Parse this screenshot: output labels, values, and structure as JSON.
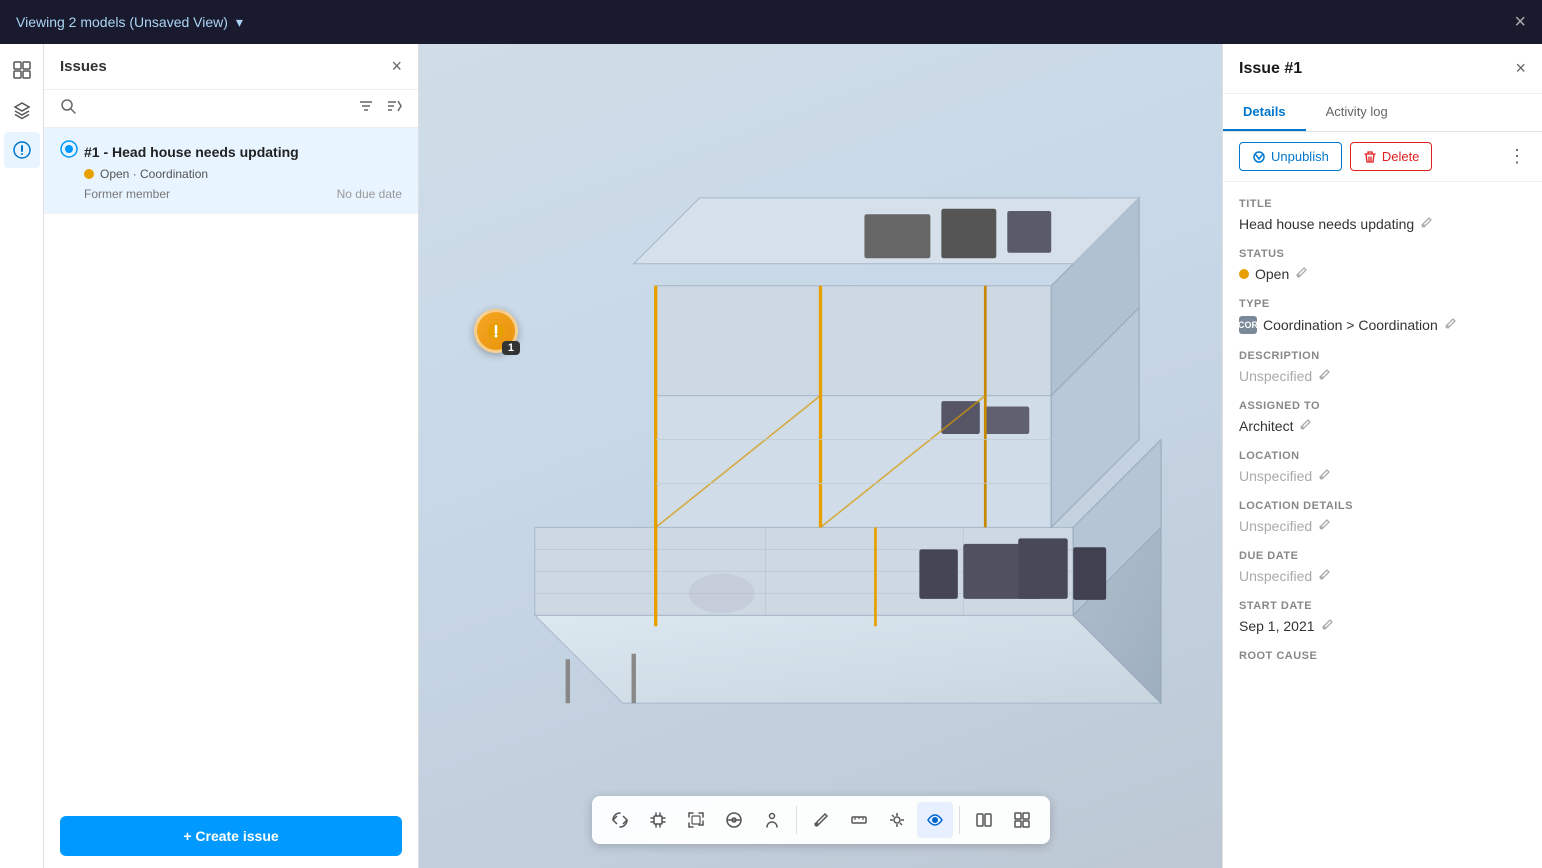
{
  "topbar": {
    "title": "Viewing 2 models (Unsaved View)",
    "close_label": "×"
  },
  "issues_panel": {
    "title": "Issues",
    "close_icon": "×",
    "search_placeholder": "Search",
    "filter_icon": "filter",
    "sort_icon": "sort",
    "issues": [
      {
        "id": "#1",
        "title": "Head house needs updating",
        "status": "Open",
        "category": "Coordination",
        "member": "Former member",
        "due_date": "No due date",
        "active": true
      }
    ],
    "create_button": "+ Create issue"
  },
  "icon_sidebar": {
    "items": [
      {
        "name": "panels-icon",
        "icon": "⊞",
        "active": false
      },
      {
        "name": "layers-icon",
        "icon": "⧉",
        "active": false
      },
      {
        "name": "issues-icon",
        "icon": "⚠",
        "active": true
      }
    ]
  },
  "viewport": {
    "marker_label": "1"
  },
  "toolbar": {
    "buttons": [
      {
        "name": "orbit-button",
        "icon": "⟳",
        "active": false,
        "tooltip": "Orbit"
      },
      {
        "name": "pan-button",
        "icon": "✋",
        "active": false,
        "tooltip": "Pan"
      },
      {
        "name": "fit-button",
        "icon": "⊡",
        "active": false,
        "tooltip": "Fit"
      },
      {
        "name": "section-button",
        "icon": "⊕",
        "active": false,
        "tooltip": "Section"
      },
      {
        "name": "person-button",
        "icon": "🚶",
        "active": false,
        "tooltip": "First person"
      },
      {
        "name": "markup-button",
        "icon": "✎",
        "active": false,
        "tooltip": "Markup"
      },
      {
        "name": "measure-button",
        "icon": "◧",
        "active": false,
        "tooltip": "Measure"
      },
      {
        "name": "explode-button",
        "icon": "❖",
        "active": false,
        "tooltip": "Explode"
      },
      {
        "name": "views-button",
        "icon": "👁",
        "active": true,
        "tooltip": "Views"
      },
      {
        "name": "split-button",
        "icon": "⊟",
        "active": false,
        "tooltip": "Split"
      },
      {
        "name": "more-button",
        "icon": "▦",
        "active": false,
        "tooltip": "More"
      }
    ]
  },
  "details_panel": {
    "title": "Issue #1",
    "close_icon": "×",
    "tabs": [
      {
        "label": "Details",
        "active": true
      },
      {
        "label": "Activity log",
        "active": false
      }
    ],
    "actions": {
      "unpublish": "Unpublish",
      "delete": "Delete"
    },
    "fields": {
      "title": {
        "label": "Title",
        "value": "Head house needs updating"
      },
      "status": {
        "label": "Status",
        "value": "Open"
      },
      "type": {
        "label": "Type",
        "value": "Coordination > Coordination",
        "badge": "COR"
      },
      "description": {
        "label": "Description",
        "value": "Unspecified",
        "unspecified": true
      },
      "assigned_to": {
        "label": "Assigned to",
        "value": "Architect",
        "unspecified": false
      },
      "location": {
        "label": "Location",
        "value": "Unspecified",
        "unspecified": true
      },
      "location_details": {
        "label": "Location details",
        "value": "Unspecified",
        "unspecified": true
      },
      "due_date": {
        "label": "Due date",
        "value": "Unspecified",
        "unspecified": true
      },
      "start_date": {
        "label": "Start date",
        "value": "Sep 1, 2021",
        "unspecified": false
      },
      "root_cause": {
        "label": "Root cause",
        "value": ""
      }
    }
  }
}
